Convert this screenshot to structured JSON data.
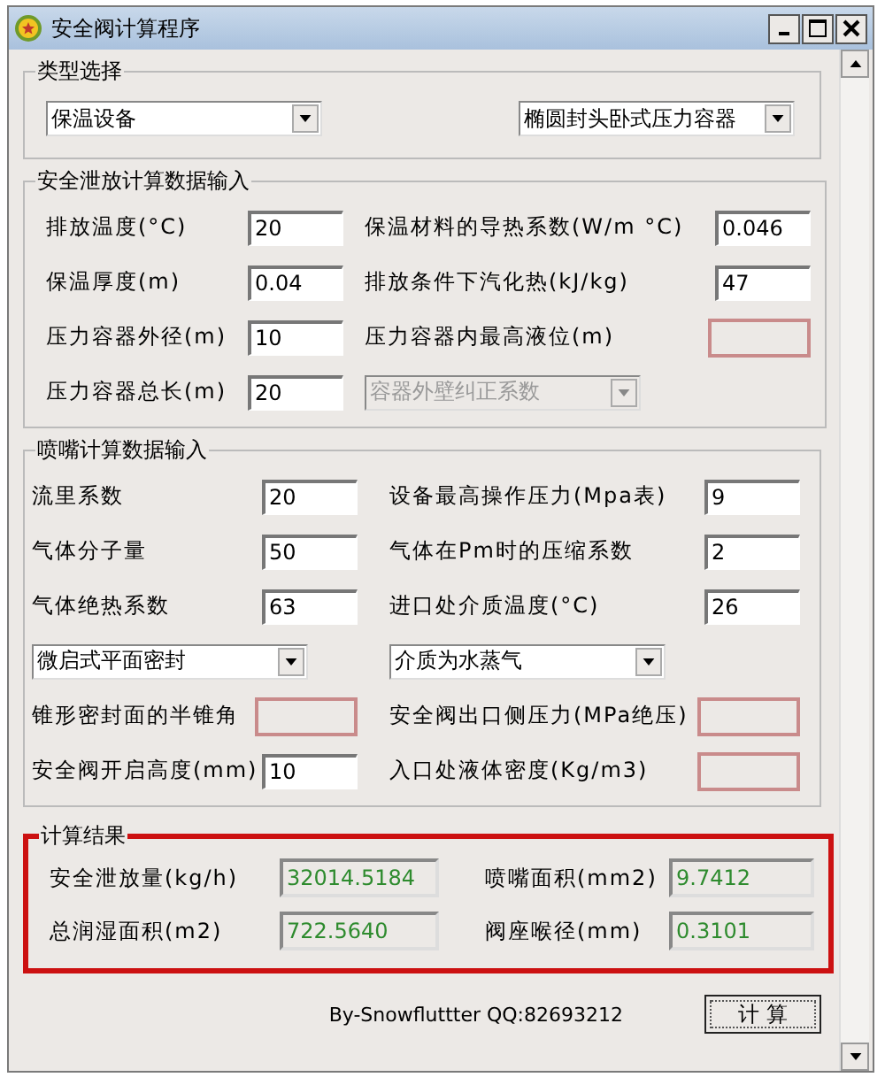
{
  "window": {
    "title": "安全阀计算程序"
  },
  "type_group": {
    "title": "类型选择",
    "selects": [
      {
        "value": "保温设备",
        "disabled": false
      },
      {
        "value": "椭圆封头卧式压力容器",
        "disabled": false
      }
    ]
  },
  "discharge_group": {
    "title": "安全泄放计算数据输入",
    "rows": [
      [
        {
          "kind": "field",
          "label": "排放温度(°C)",
          "value": "20"
        },
        {
          "kind": "field",
          "label": "保温材料的导热系数(W/m °C)",
          "value": "0.046"
        }
      ],
      [
        {
          "kind": "field",
          "label": "保温厚度(m)",
          "value": "0.04"
        },
        {
          "kind": "field",
          "label": "排放条件下汽化热(kJ/kg)",
          "value": "47"
        }
      ],
      [
        {
          "kind": "field",
          "label": "压力容器外径(m)",
          "value": "10"
        },
        {
          "kind": "flagged",
          "label": "压力容器内最高液位(m)"
        }
      ],
      [
        {
          "kind": "field",
          "label": "压力容器总长(m)",
          "value": "20"
        },
        {
          "kind": "select",
          "value": "容器外壁纠正系数",
          "disabled": true
        }
      ]
    ]
  },
  "nozzle_group": {
    "title": "喷嘴计算数据输入",
    "rows": [
      [
        {
          "kind": "field",
          "label": "流里系数",
          "value": "20"
        },
        {
          "kind": "field",
          "label": "设备最高操作压力(Mpa表)",
          "value": "9"
        }
      ],
      [
        {
          "kind": "field",
          "label": "气体分子量",
          "value": "50"
        },
        {
          "kind": "field",
          "label": "气体在Pm时的压缩系数",
          "value": "2"
        }
      ],
      [
        {
          "kind": "field",
          "label": "气体绝热系数",
          "value": "63"
        },
        {
          "kind": "field",
          "label": "进口处介质温度(°C)",
          "value": "26"
        }
      ],
      [
        {
          "kind": "select",
          "value": "微启式平面密封",
          "disabled": false
        },
        {
          "kind": "select",
          "value": "介质为水蒸气",
          "disabled": false
        }
      ],
      [
        {
          "kind": "flagged",
          "label": "锥形密封面的半锥角"
        },
        {
          "kind": "flagged",
          "label": "安全阀出口侧压力(MPa绝压)"
        }
      ],
      [
        {
          "kind": "field",
          "label": "安全阀开启高度(mm)",
          "value": "10"
        },
        {
          "kind": "flagged",
          "label": "入口处液体密度(Kg/m3)"
        }
      ]
    ]
  },
  "results_group": {
    "title": "计算结果",
    "highlighted": true,
    "rows": [
      [
        {
          "label": "安全泄放量(kg/h)",
          "value": "32014.5184"
        },
        {
          "label": "喷嘴面积(mm2)",
          "value": "9.7412"
        }
      ],
      [
        {
          "label": "总润湿面积(m2)",
          "value": "722.5640"
        },
        {
          "label": "阀座喉径(mm)",
          "value": "0.3101"
        }
      ]
    ]
  },
  "footer": {
    "credit": "By-Snowfluttter  QQ:82693212",
    "button": "计 算"
  }
}
